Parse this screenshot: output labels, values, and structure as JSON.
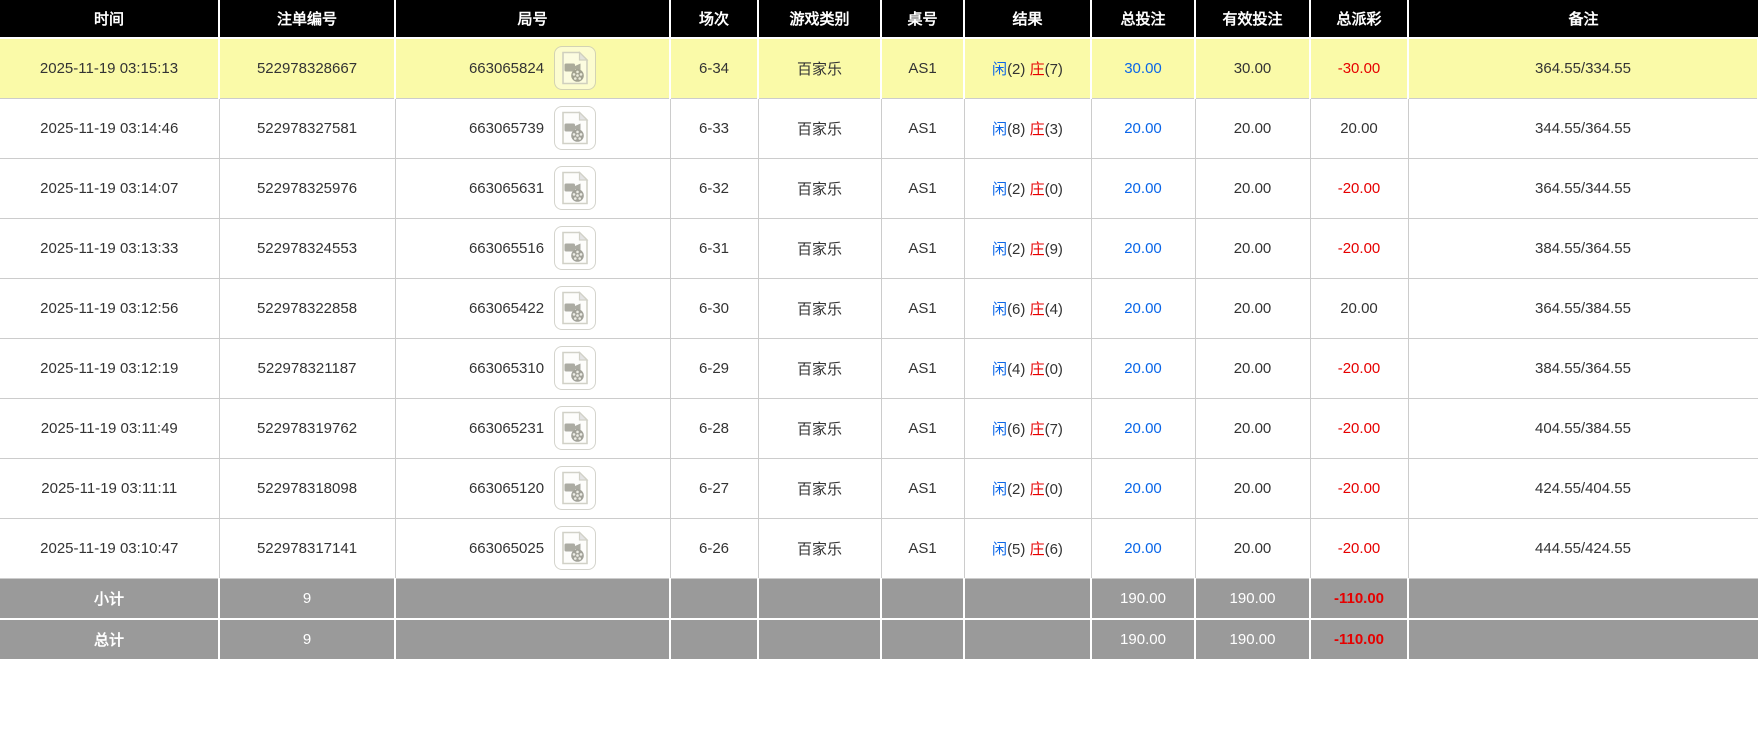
{
  "colors": {
    "header_bg": "#000000",
    "highlight_row_bg": "#fafaa8",
    "summary_bg": "#9a9a9a",
    "blue": "#0a66e8",
    "red": "#e60000",
    "text": "#333333",
    "grid": "#cccccc"
  },
  "icons": {
    "round_video": "video-file"
  },
  "table": {
    "headers": [
      "时间",
      "注单编号",
      "局号",
      "场次",
      "游戏类别",
      "桌号",
      "结果",
      "总投注",
      "有效投注",
      "总派彩",
      "备注"
    ]
  },
  "rows": [
    {
      "highlighted": true,
      "time": "2025-11-19 03:15:13",
      "bet_id": "522978328667",
      "round_id": "663065824",
      "session": "6-34",
      "game_type": "百家乐",
      "table_no": "AS1",
      "result": {
        "xian_label": "闲",
        "xian_value": "(2)",
        "zhuang_label": "庄",
        "zhuang_value": "(7)"
      },
      "total_bet": "30.00",
      "valid_bet": "30.00",
      "payout": "-30.00",
      "remark": "364.55/334.55"
    },
    {
      "highlighted": false,
      "time": "2025-11-19 03:14:46",
      "bet_id": "522978327581",
      "round_id": "663065739",
      "session": "6-33",
      "game_type": "百家乐",
      "table_no": "AS1",
      "result": {
        "xian_label": "闲",
        "xian_value": "(8)",
        "zhuang_label": "庄",
        "zhuang_value": "(3)"
      },
      "total_bet": "20.00",
      "valid_bet": "20.00",
      "payout": "20.00",
      "remark": "344.55/364.55"
    },
    {
      "highlighted": false,
      "time": "2025-11-19 03:14:07",
      "bet_id": "522978325976",
      "round_id": "663065631",
      "session": "6-32",
      "game_type": "百家乐",
      "table_no": "AS1",
      "result": {
        "xian_label": "闲",
        "xian_value": "(2)",
        "zhuang_label": "庄",
        "zhuang_value": "(0)"
      },
      "total_bet": "20.00",
      "valid_bet": "20.00",
      "payout": "-20.00",
      "remark": "364.55/344.55"
    },
    {
      "highlighted": false,
      "time": "2025-11-19 03:13:33",
      "bet_id": "522978324553",
      "round_id": "663065516",
      "session": "6-31",
      "game_type": "百家乐",
      "table_no": "AS1",
      "result": {
        "xian_label": "闲",
        "xian_value": "(2)",
        "zhuang_label": "庄",
        "zhuang_value": "(9)"
      },
      "total_bet": "20.00",
      "valid_bet": "20.00",
      "payout": "-20.00",
      "remark": "384.55/364.55"
    },
    {
      "highlighted": false,
      "time": "2025-11-19 03:12:56",
      "bet_id": "522978322858",
      "round_id": "663065422",
      "session": "6-30",
      "game_type": "百家乐",
      "table_no": "AS1",
      "result": {
        "xian_label": "闲",
        "xian_value": "(6)",
        "zhuang_label": "庄",
        "zhuang_value": "(4)"
      },
      "total_bet": "20.00",
      "valid_bet": "20.00",
      "payout": "20.00",
      "remark": "364.55/384.55"
    },
    {
      "highlighted": false,
      "time": "2025-11-19 03:12:19",
      "bet_id": "522978321187",
      "round_id": "663065310",
      "session": "6-29",
      "game_type": "百家乐",
      "table_no": "AS1",
      "result": {
        "xian_label": "闲",
        "xian_value": "(4)",
        "zhuang_label": "庄",
        "zhuang_value": "(0)"
      },
      "total_bet": "20.00",
      "valid_bet": "20.00",
      "payout": "-20.00",
      "remark": "384.55/364.55"
    },
    {
      "highlighted": false,
      "time": "2025-11-19 03:11:49",
      "bet_id": "522978319762",
      "round_id": "663065231",
      "session": "6-28",
      "game_type": "百家乐",
      "table_no": "AS1",
      "result": {
        "xian_label": "闲",
        "xian_value": "(6)",
        "zhuang_label": "庄",
        "zhuang_value": "(7)"
      },
      "total_bet": "20.00",
      "valid_bet": "20.00",
      "payout": "-20.00",
      "remark": "404.55/384.55"
    },
    {
      "highlighted": false,
      "time": "2025-11-19 03:11:11",
      "bet_id": "522978318098",
      "round_id": "663065120",
      "session": "6-27",
      "game_type": "百家乐",
      "table_no": "AS1",
      "result": {
        "xian_label": "闲",
        "xian_value": "(2)",
        "zhuang_label": "庄",
        "zhuang_value": "(0)"
      },
      "total_bet": "20.00",
      "valid_bet": "20.00",
      "payout": "-20.00",
      "remark": "424.55/404.55"
    },
    {
      "highlighted": false,
      "time": "2025-11-19 03:10:47",
      "bet_id": "522978317141",
      "round_id": "663065025",
      "session": "6-26",
      "game_type": "百家乐",
      "table_no": "AS1",
      "result": {
        "xian_label": "闲",
        "xian_value": "(5)",
        "zhuang_label": "庄",
        "zhuang_value": "(6)"
      },
      "total_bet": "20.00",
      "valid_bet": "20.00",
      "payout": "-20.00",
      "remark": "444.55/424.55"
    }
  ],
  "summary": {
    "subtotal": {
      "label": "小计",
      "count": "9",
      "total_bet": "190.00",
      "valid_bet": "190.00",
      "payout": "-110.00"
    },
    "total": {
      "label": "总计",
      "count": "9",
      "total_bet": "190.00",
      "valid_bet": "190.00",
      "payout": "-110.00"
    }
  }
}
